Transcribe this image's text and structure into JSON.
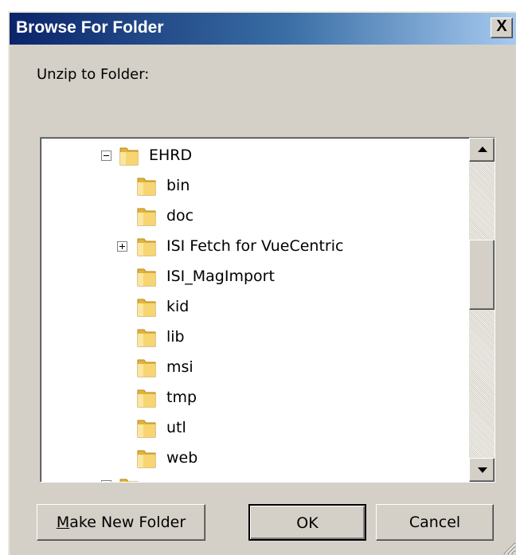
{
  "dialog": {
    "title": "Browse For Folder",
    "close_label": "X",
    "prompt": "Unzip to Folder:"
  },
  "tree": {
    "parent": {
      "label": "EHRD",
      "expanded": true,
      "icon": "folder-icon"
    },
    "children": [
      {
        "label": "bin",
        "has_children": false
      },
      {
        "label": "doc",
        "has_children": false
      },
      {
        "label": "ISI Fetch for VueCentric",
        "has_children": true
      },
      {
        "label": "ISI_MagImport",
        "has_children": false
      },
      {
        "label": "kid",
        "has_children": false
      },
      {
        "label": "lib",
        "has_children": false
      },
      {
        "label": "msi",
        "has_children": false
      },
      {
        "label": "tmp",
        "has_children": false
      },
      {
        "label": "utl",
        "has_children": false
      },
      {
        "label": "web",
        "has_children": false
      }
    ]
  },
  "scrollbar": {
    "position_fraction": 0.35,
    "icons": [
      "arrow-up-icon",
      "arrow-down-icon"
    ]
  },
  "buttons": {
    "make_new_folder_mnemonic": "M",
    "make_new_folder_rest": "ake New Folder",
    "ok": "OK",
    "cancel": "Cancel"
  },
  "colors": {
    "titlebar_start": "#0a246a",
    "titlebar_end": "#a6caf0",
    "face": "#d4d0c8",
    "folder": "#f0c64c"
  }
}
